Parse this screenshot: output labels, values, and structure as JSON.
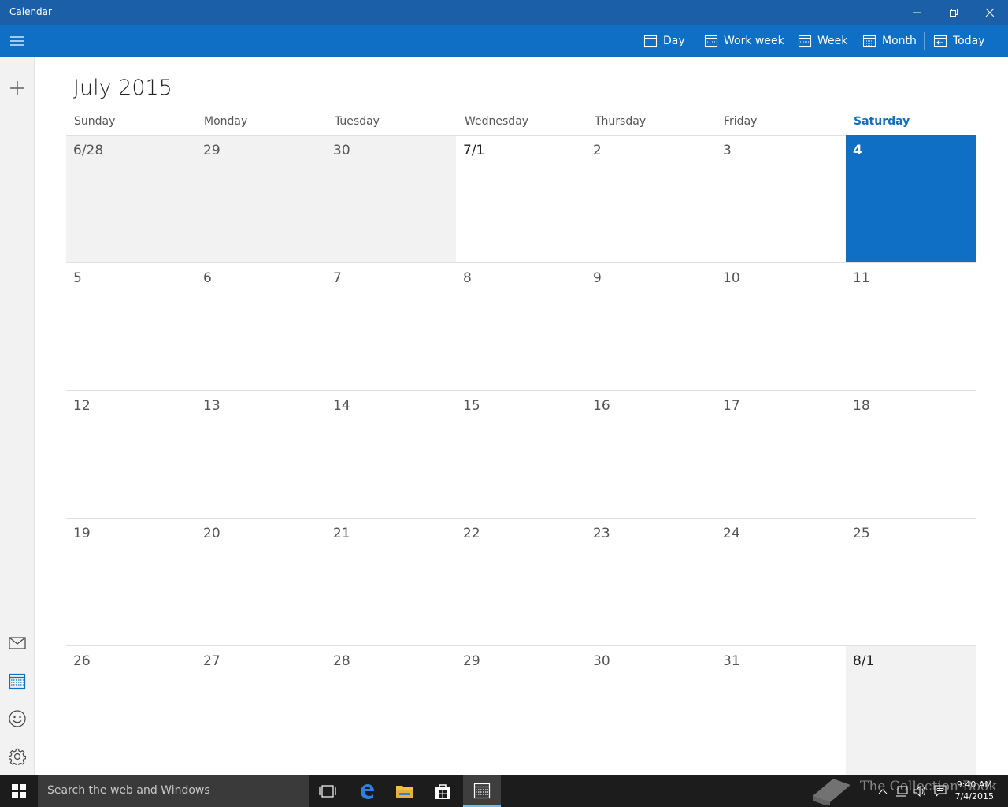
{
  "window": {
    "title": "Calendar"
  },
  "commandbar": {
    "views": [
      {
        "label": "Day",
        "icon": "day-icon"
      },
      {
        "label": "Work week",
        "icon": "work-week-icon"
      },
      {
        "label": "Week",
        "icon": "week-icon"
      },
      {
        "label": "Month",
        "icon": "month-icon"
      },
      {
        "label": "Today",
        "icon": "today-icon"
      }
    ]
  },
  "calendar": {
    "month_title": "July 2015",
    "weekdays": [
      "Sunday",
      "Monday",
      "Tuesday",
      "Wednesday",
      "Thursday",
      "Friday",
      "Saturday"
    ],
    "today_weekday": "Saturday",
    "weeks": [
      [
        "6/28",
        "29",
        "30",
        "7/1",
        "2",
        "3",
        "4"
      ],
      [
        "5",
        "6",
        "7",
        "8",
        "9",
        "10",
        "11"
      ],
      [
        "12",
        "13",
        "14",
        "15",
        "16",
        "17",
        "18"
      ],
      [
        "19",
        "20",
        "21",
        "22",
        "23",
        "24",
        "25"
      ],
      [
        "26",
        "27",
        "28",
        "29",
        "30",
        "31",
        "8/1"
      ]
    ],
    "today": "4",
    "accent_color": "#0e6fc4"
  },
  "rail": {
    "items": [
      "add-event-icon",
      "mail-icon",
      "calendar-icon",
      "people-icon",
      "settings-icon"
    ]
  },
  "taskbar": {
    "search_placeholder": "Search the web and Windows",
    "time": "9:40 AM",
    "date": "7/4/2015"
  },
  "watermark": {
    "text": "The Collection Book"
  }
}
